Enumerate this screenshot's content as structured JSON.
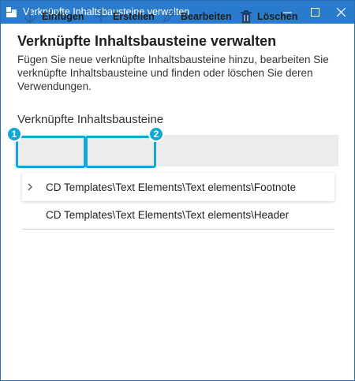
{
  "window": {
    "title": "Verknüpfte Inhaltsbausteine verwalten"
  },
  "dialog": {
    "heading": "Verknüpfte Inhaltsbausteine verwalten",
    "description": "Fügen Sie neue verknüpfte Inhaltsbausteine hinzu, bearbeiten Sie verknüpfte Inhaltsbausteine und finden oder löschen Sie deren Verwendungen.",
    "section_label": "Verknüpfte Inhaltsbausteine"
  },
  "toolbar": {
    "insert_label": "Einfügen",
    "create_label": "Erstellen",
    "edit_label": "Bearbeiten",
    "delete_label": "Löschen"
  },
  "callouts": [
    "1",
    "2"
  ],
  "list": {
    "items": [
      {
        "label": "CD Templates\\Text Elements\\Text elements\\Footnote",
        "expandable": true
      },
      {
        "label": "CD Templates\\Text Elements\\Text elements\\Header",
        "expandable": false
      }
    ]
  },
  "colors": {
    "titlebar": "#2b7bcc",
    "highlight": "#12a7d6",
    "toolbar_bg": "#ececec"
  },
  "icons": {
    "app": "app-window-icon",
    "minimize": "minimize-icon",
    "maximize": "maximize-icon",
    "close": "close-icon",
    "insert": "arrow-down-icon",
    "create": "plus-icon",
    "edit": "pencil-icon",
    "delete": "trash-icon",
    "expand": "chevron-right-icon"
  }
}
